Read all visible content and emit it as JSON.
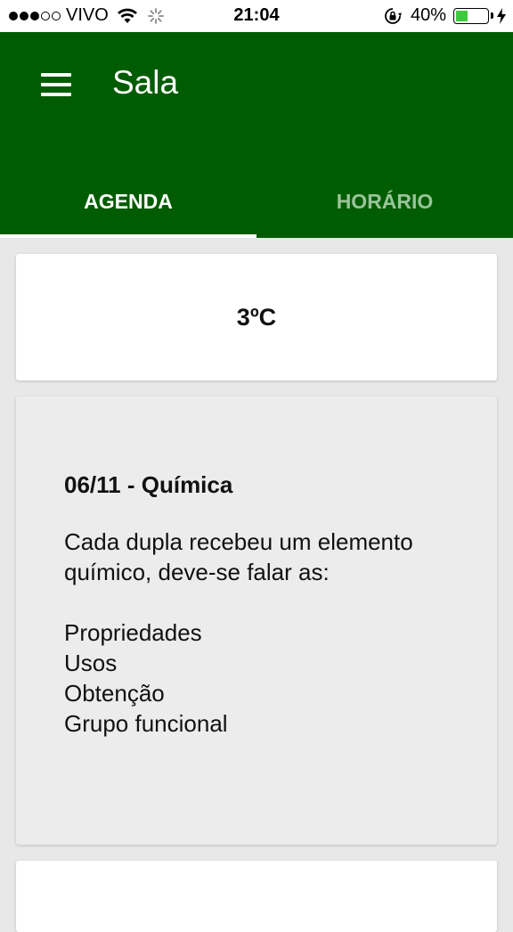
{
  "status_bar": {
    "carrier": "VIVO",
    "time": "21:04",
    "battery_percent": "40%",
    "battery_level": 0.4,
    "signal_bars_filled": 3,
    "signal_bars_total": 5
  },
  "app_bar": {
    "title": "Sala",
    "background_color": "#005c00"
  },
  "tabs": [
    {
      "label": "AGENDA",
      "active": true
    },
    {
      "label": "HORÁRIO",
      "active": false
    }
  ],
  "weather": {
    "temperature": "3ºC"
  },
  "agenda": {
    "title": "06/11 - Química",
    "description": "Cada dupla recebeu um elemento químico, deve-se falar as:",
    "items": [
      "Propriedades",
      "Usos",
      "Obtenção",
      "Grupo funcional"
    ]
  },
  "icons": {
    "menu": "menu-icon",
    "wifi": "wifi-icon",
    "loading": "loading-spinner-icon",
    "rotation_lock": "rotation-lock-icon",
    "battery": "battery-icon",
    "charging": "charging-bolt-icon"
  }
}
